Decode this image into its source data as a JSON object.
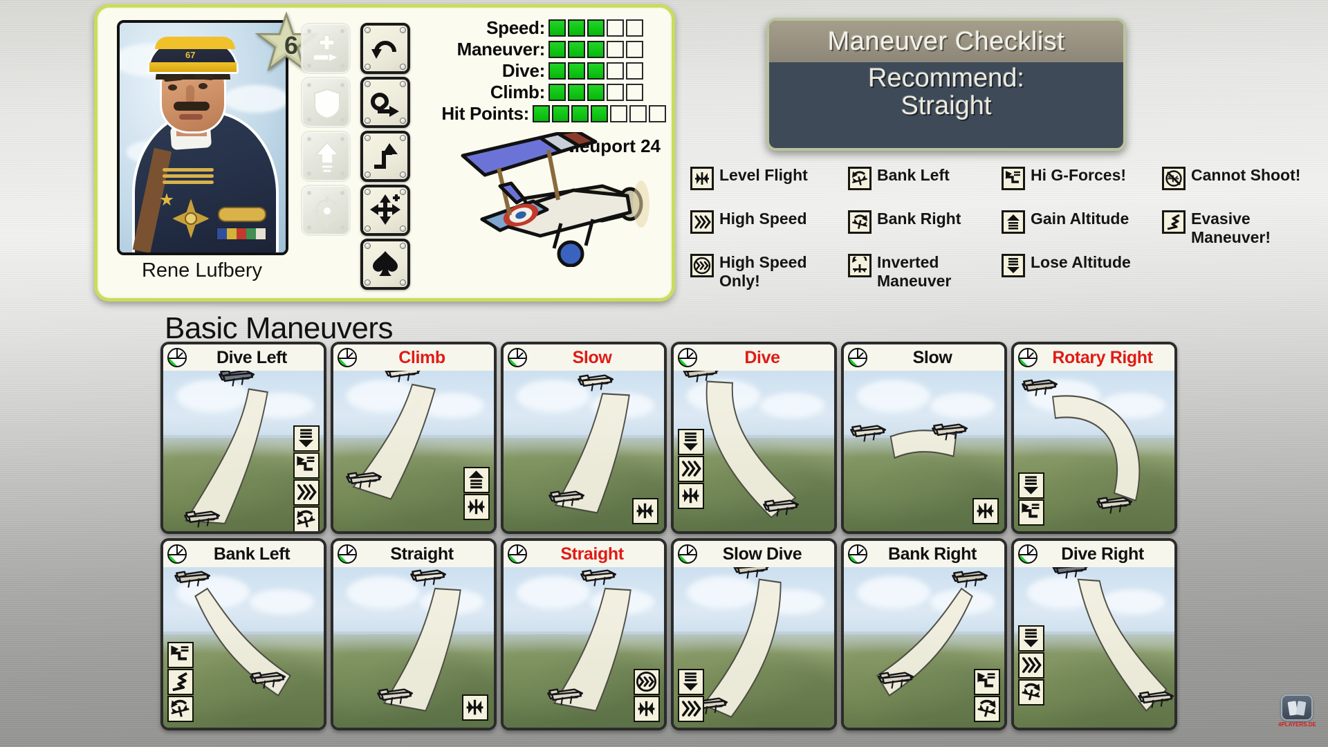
{
  "pilot_card": {
    "pilot_name": "Rene Lufbery",
    "rank_number": "6",
    "cap_number": "67",
    "plane_name": "Nieuport 24",
    "stats": [
      {
        "label": "Speed:",
        "filled": 3,
        "total": 5
      },
      {
        "label": "Maneuver:",
        "filled": 3,
        "total": 5
      },
      {
        "label": "Dive:",
        "filled": 3,
        "total": 5
      },
      {
        "label": "Climb:",
        "filled": 3,
        "total": 5
      },
      {
        "label": "Hit Points:",
        "filled": 4,
        "total": 7
      }
    ],
    "ability_buttons": [
      {
        "name": "repair-ability-button",
        "icon": "wrench-plus-icon",
        "enabled": false
      },
      {
        "name": "defense-ability-button",
        "icon": "shield-icon",
        "enabled": false
      },
      {
        "name": "boost-ability-button",
        "icon": "up-arrow-icon",
        "enabled": false
      },
      {
        "name": "target-ability-button",
        "icon": "crosshair-icon",
        "enabled": false
      }
    ],
    "maneuver_buttons": [
      {
        "name": "loop-left-button",
        "icon": "loop-ccw-icon",
        "enabled": true
      },
      {
        "name": "immelmann-button",
        "icon": "loop-exit-icon",
        "enabled": true
      },
      {
        "name": "sidestep-button",
        "icon": "step-turn-icon",
        "enabled": true
      },
      {
        "name": "reposition-button",
        "icon": "four-arrows-icon",
        "enabled": true
      },
      {
        "name": "advance-button",
        "icon": "spade-icon",
        "enabled": true
      }
    ]
  },
  "checklist": {
    "title": "Maneuver Checklist",
    "recommend_label": "Recommend:",
    "recommend_value": "Straight"
  },
  "legend": {
    "columns": [
      [
        {
          "icon": "level-flight-icon",
          "label": "Level Flight"
        },
        {
          "icon": "high-speed-icon",
          "label": "High Speed"
        },
        {
          "icon": "high-speed-only-icon",
          "label": "High Speed\nOnly!"
        }
      ],
      [
        {
          "icon": "bank-left-icon",
          "label": "Bank Left"
        },
        {
          "icon": "bank-right-icon",
          "label": "Bank Right"
        },
        {
          "icon": "inverted-icon",
          "label": "Inverted\nManeuver"
        }
      ],
      [
        {
          "icon": "hi-g-forces-icon",
          "label": "Hi G-Forces!"
        },
        {
          "icon": "gain-altitude-icon",
          "label": "Gain Altitude"
        },
        {
          "icon": "lose-altitude-icon",
          "label": "Lose Altitude"
        }
      ],
      [
        {
          "icon": "cannot-shoot-icon",
          "label": "Cannot Shoot!"
        },
        {
          "icon": "evasive-icon",
          "label": "Evasive\nManeuver!"
        }
      ]
    ]
  },
  "basic_maneuvers": {
    "section_title": "Basic Maneuvers",
    "rows": [
      [
        {
          "title": "Dive Left",
          "highlight": false,
          "symbols": [
            "lose-altitude-icon",
            "hi-g-forces-icon",
            "high-speed-icon",
            "bank-left-icon"
          ],
          "path": "dive-left",
          "terrain": "hills"
        },
        {
          "title": "Climb",
          "highlight": true,
          "symbols": [
            "gain-altitude-icon",
            "level-flight-icon"
          ],
          "path": "climb",
          "terrain": "hills"
        },
        {
          "title": "Slow",
          "highlight": true,
          "symbols": [
            "level-flight-icon"
          ],
          "path": "slow",
          "terrain": "fields"
        },
        {
          "title": "Dive",
          "highlight": true,
          "symbols": [
            "lose-altitude-icon",
            "high-speed-icon",
            "level-flight-icon"
          ],
          "path": "dive",
          "terrain": "fields"
        },
        {
          "title": "Slow",
          "highlight": false,
          "symbols": [
            "level-flight-icon"
          ],
          "path": "slow-right",
          "terrain": "fields"
        },
        {
          "title": "Rotary Right",
          "highlight": true,
          "symbols": [
            "lose-altitude-icon",
            "hi-g-forces-icon"
          ],
          "path": "rotary-right",
          "terrain": "hills"
        }
      ],
      [
        {
          "title": "Bank Left",
          "highlight": false,
          "symbols": [
            "hi-g-forces-icon",
            "evasive-icon",
            "bank-left-icon"
          ],
          "path": "bank-left",
          "terrain": "hills"
        },
        {
          "title": "Straight",
          "highlight": false,
          "symbols": [
            "level-flight-icon"
          ],
          "path": "straight",
          "terrain": "fields"
        },
        {
          "title": "Straight",
          "highlight": true,
          "symbols": [
            "high-speed-only-icon",
            "level-flight-icon"
          ],
          "path": "straight",
          "terrain": "fields"
        },
        {
          "title": "Slow Dive",
          "highlight": false,
          "symbols": [
            "lose-altitude-icon",
            "high-speed-icon"
          ],
          "path": "slow-dive",
          "terrain": "hills"
        },
        {
          "title": "Bank Right",
          "highlight": false,
          "symbols": [
            "hi-g-forces-icon",
            "bank-right-icon"
          ],
          "path": "bank-right",
          "terrain": "hills"
        },
        {
          "title": "Dive Right",
          "highlight": false,
          "symbols": [
            "lose-altitude-icon",
            "high-speed-icon",
            "bank-right-icon"
          ],
          "path": "dive-right",
          "terrain": "hills"
        }
      ]
    ]
  },
  "watermark": {
    "text": "4PLAYERS.DE"
  },
  "colors": {
    "pip_on": "#11c414",
    "highlight_text": "#e01b16",
    "card_frame": "#c9dd5c",
    "checklist_bg": "#3f4a58",
    "checklist_title_bg": "#9a9383"
  }
}
